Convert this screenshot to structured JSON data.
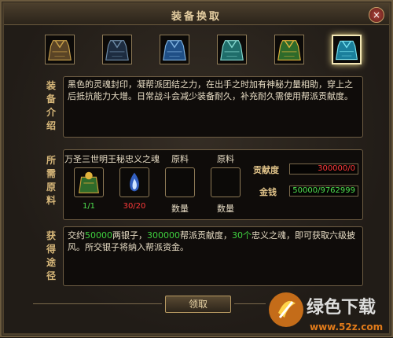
{
  "window": {
    "title": "装备换取",
    "close_glyph": "×"
  },
  "equipment": [
    {
      "name": "cloak-brown-icon",
      "selected": false,
      "colors": [
        "#5a4426",
        "#c9a14a"
      ]
    },
    {
      "name": "cloak-dark-blue-icon",
      "selected": false,
      "colors": [
        "#1d2c40",
        "#6e8ca8"
      ]
    },
    {
      "name": "cloak-blue-icon",
      "selected": false,
      "colors": [
        "#1f4f86",
        "#7fb2e0"
      ]
    },
    {
      "name": "cloak-teal-icon",
      "selected": false,
      "colors": [
        "#1f6d6a",
        "#86d8d0"
      ]
    },
    {
      "name": "cloak-gold-green-icon",
      "selected": false,
      "colors": [
        "#2e6a2a",
        "#e0b23c"
      ]
    },
    {
      "name": "cloak-cyan-icon",
      "selected": true,
      "colors": [
        "#1a7f9c",
        "#7ee8f5"
      ]
    }
  ],
  "sections": {
    "description_label": "装备介绍",
    "materials_label": "所需原料",
    "route_label": "获得途径"
  },
  "description": "黑色的灵魂封印，凝帮派团结之力，在出手之时加有神秘力量相助，穿上之后抵抗能力大增。日常战斗会减少装备耐久，补充耐久需使用帮派贡献度。",
  "materials": [
    {
      "name": "万圣三世明王秘忠义之魂",
      "count": "1/1",
      "count_color": "#4fe04f",
      "icon": "soul-item-icon"
    },
    {
      "name": "",
      "count": "30/20",
      "count_color": "#ff3a3a",
      "icon": "blue-flame-icon"
    },
    {
      "name": "原料",
      "count": "数量",
      "count_color": "#e7dcc4",
      "icon": "empty-slot-icon"
    },
    {
      "name": "原料",
      "count": "数量",
      "count_color": "#e7dcc4",
      "icon": "empty-slot-icon"
    }
  ],
  "stats": {
    "contribution_label": "贡献度",
    "contribution_value": "300000/0",
    "contribution_color": "#ff3a3a",
    "money_label": "金钱",
    "money_value": "50000/9762999",
    "money_color": "#4fe04f"
  },
  "route": {
    "part1": "交约",
    "money": "50000",
    "part2": "两银子，",
    "contrib": "300000",
    "part3": "帮派贡献度，",
    "souls": "30个",
    "part4": "忠义之魂，即可获取六级披风。所交银子将纳入帮派资金。",
    "highlight_color": "#3fd23f"
  },
  "confirm_label": "领取",
  "watermark": {
    "brand": "绿色下载",
    "site": "www.52z.com"
  }
}
